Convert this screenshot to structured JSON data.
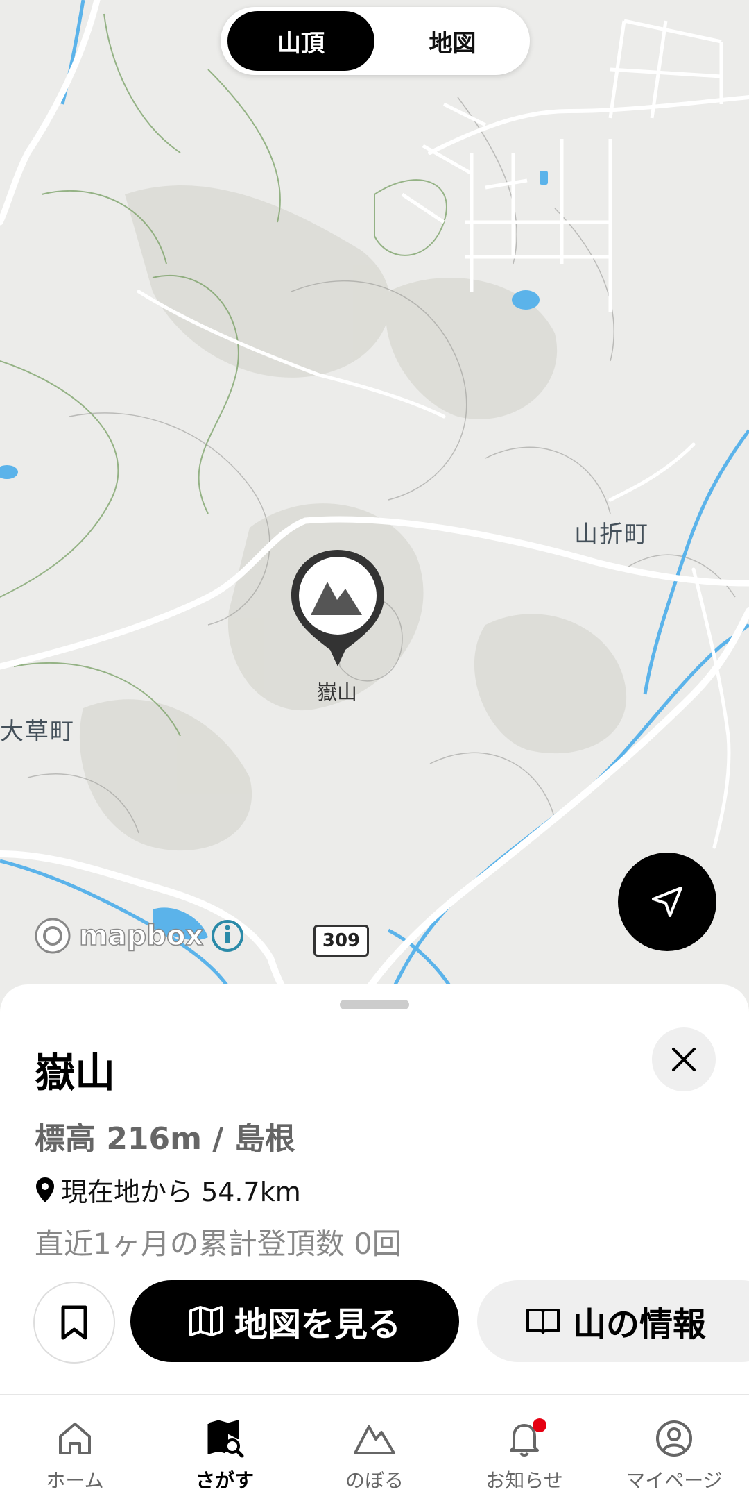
{
  "segment": {
    "summit_label": "山頂",
    "map_label": "地図",
    "active": "summit"
  },
  "map": {
    "place_names": [
      "山折町",
      "大草町"
    ],
    "peak_label": "嶽山",
    "route_number": "309",
    "attribution": "mapbox",
    "water_color": "#5bb3ea",
    "contour_color": "#6f9a5a"
  },
  "sheet": {
    "title": "嶽山",
    "meta": "標高 216m / 島根",
    "distance": "現在地から 54.7km",
    "climbs": "直近1ヶ月の累計登頂数 0回",
    "map_button": "地図を見る",
    "info_button": "山の情報"
  },
  "tabs": [
    {
      "label": "ホーム",
      "icon": "home-icon"
    },
    {
      "label": "さがす",
      "icon": "map-search-icon",
      "active": true
    },
    {
      "label": "のぼる",
      "icon": "mountain-icon"
    },
    {
      "label": "お知らせ",
      "icon": "bell-icon",
      "badge": true
    },
    {
      "label": "マイページ",
      "icon": "user-icon"
    }
  ],
  "colors": {
    "accent": "#000000",
    "badge": "#e50012"
  }
}
